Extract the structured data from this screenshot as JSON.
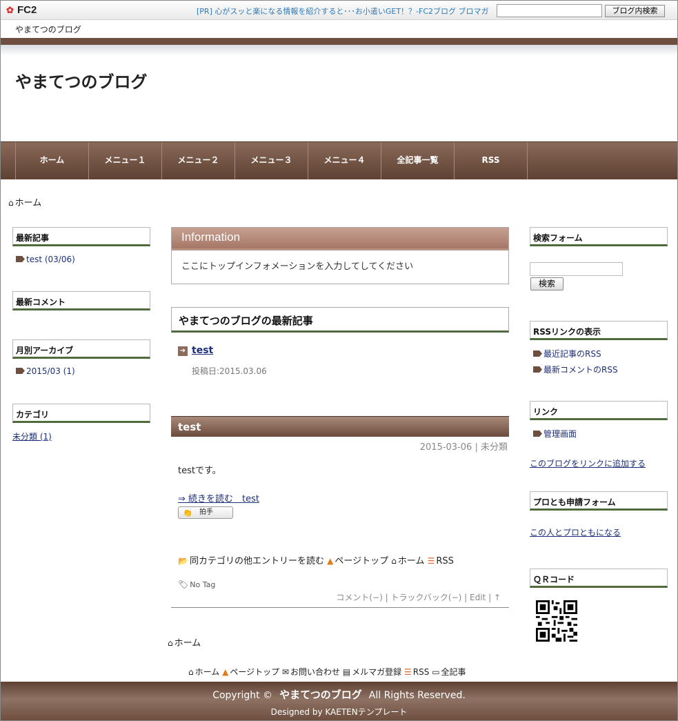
{
  "fc2bar": {
    "logo": "FC2",
    "pr_text": "[PR] 心がスッと楽になる情報を紹介すると･･･お小遣いGET！？-FC2ブログ ブロマガ",
    "search_button": "ブログ内検索",
    "search_value": ""
  },
  "blog_name_line": "やまてつのブログ",
  "site_title": "やまてつのブログ",
  "nav": [
    "ホーム",
    "メニュー１",
    "メニュー２",
    "メニュー３",
    "メニュー４",
    "全記事一覧",
    "RSS"
  ],
  "breadcrumb_home": "ホーム",
  "left_sidebar": {
    "recent_entries_title": "最新記事",
    "recent_entry": "test (03/06)",
    "recent_comments_title": "最新コメント",
    "archive_title": "月別アーカイブ",
    "archive_item": "2015/03 (1)",
    "category_title": "カテゴリ",
    "category_item": "未分類 (1)"
  },
  "info": {
    "title": "Information",
    "body": "ここにトップインフォメーションを入力してしてください"
  },
  "latest": {
    "title": "やまてつのブログの最新記事",
    "item_title": "test",
    "item_date": "投稿日:2015.03.06"
  },
  "entry": {
    "title": "test",
    "date": "2015-03-06",
    "category": "未分類",
    "body": "testです。",
    "more": "⇒ 続きを読む　test",
    "clap_label": "拍手",
    "same_category": "同カテゴリの他エントリーを読む",
    "page_top": "ページトップ",
    "home": "ホーム",
    "rss": "RSS",
    "no_tag": "No Tag",
    "comment": "コメント(−)",
    "trackback": "トラックバック(−)",
    "edit": "Edit",
    "up": "↑"
  },
  "right_sidebar": {
    "search_title": "検索フォーム",
    "search_button": "検索",
    "rss_title": "RSSリンクの表示",
    "rss_recent": "最近記事のRSS",
    "rss_comments": "最新コメントのRSS",
    "link_title": "リンク",
    "link_admin": "管理画面",
    "link_add": "このブログをリンクに追加する",
    "proto_title": "プロとも申請フォーム",
    "proto_link": "この人とプロともになる",
    "qr_title": "ＱＲコード"
  },
  "footer_links": {
    "home": "ホーム",
    "page_top": "ページトップ",
    "contact": "お問い合わせ",
    "mail": "メルマガ登録",
    "rss": "RSS",
    "all": "全記事"
  },
  "footer": {
    "copyright_prefix": "Copyright ©",
    "blog_name": "やまてつのブログ",
    "rights": "All Rights Reserved.",
    "designed": "Designed by KAETENテンプレート"
  },
  "colors": {
    "brown": "#6e4f3f",
    "green_rule": "#4f6b3b",
    "link": "#1c2e7a",
    "pr_link": "#2a79b8"
  }
}
